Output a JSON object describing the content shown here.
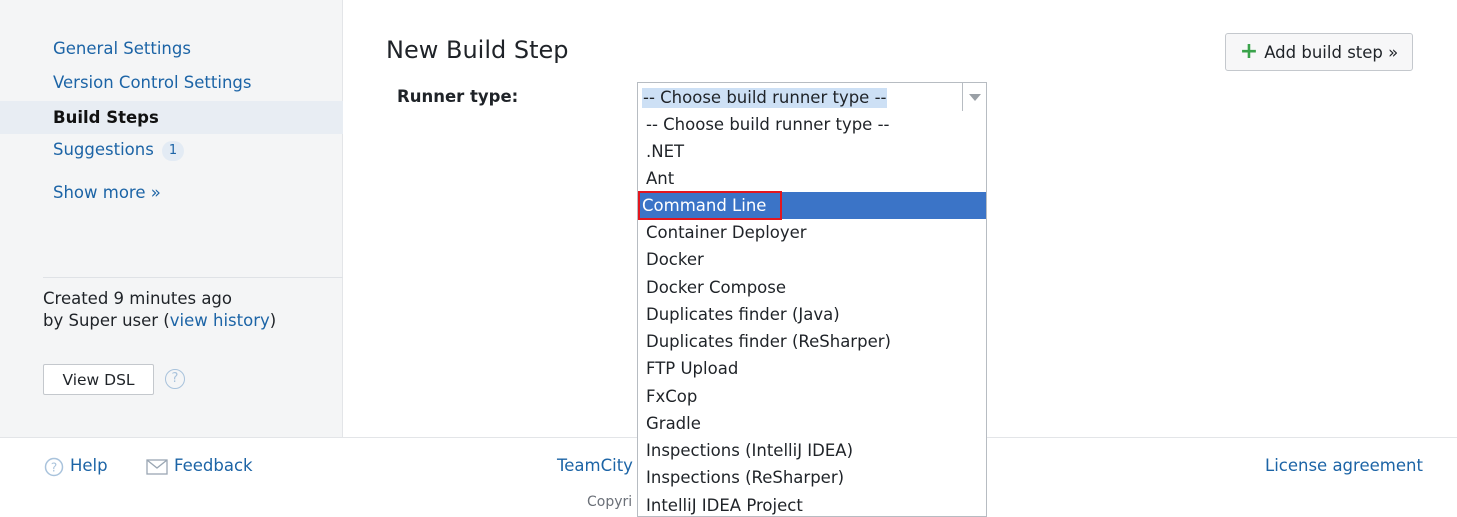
{
  "sidebar": {
    "items": [
      {
        "label": "General Settings"
      },
      {
        "label": "Version Control Settings"
      },
      {
        "label": "Build Steps"
      },
      {
        "label": "Suggestions",
        "badge": "1"
      }
    ],
    "show_more": "Show more »",
    "created_line": "Created 9 minutes ago",
    "by_prefix": "by Super user  (",
    "view_history": "view history",
    "by_suffix": ")",
    "view_dsl": "View DSL",
    "help_glyph": "?"
  },
  "main": {
    "title": "New Build Step",
    "add_step": "Add build step »",
    "runner_label": "Runner type:",
    "select_value": "-- Choose build runner type --",
    "options": [
      "-- Choose build runner type --",
      ".NET",
      "Ant",
      "Command Line",
      "Container Deployer",
      "Docker",
      "Docker Compose",
      "Duplicates finder (Java)",
      "Duplicates finder (ReSharper)",
      "FTP Upload",
      "FxCop",
      "Gradle",
      "Inspections (IntelliJ IDEA)",
      "Inspections (ReSharper)",
      "IntelliJ IDEA Project"
    ],
    "selected_option": "Command Line"
  },
  "footer": {
    "help": "Help",
    "feedback": "Feedback",
    "teamcity": "TeamCity",
    "license": "License agreement",
    "copyright": "Copyri"
  },
  "colors": {
    "link": "#1c64a6",
    "selection": "#3b74c7",
    "highlight_box": "#e2161e",
    "add_icon": "#3aa34b"
  }
}
